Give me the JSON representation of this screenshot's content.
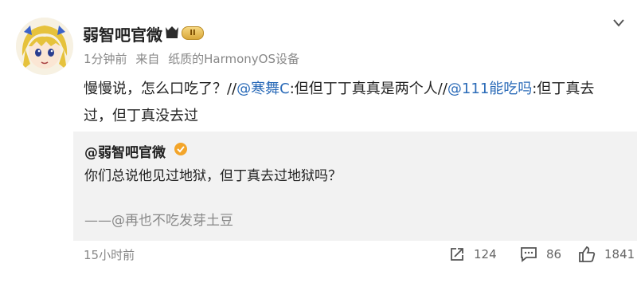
{
  "post": {
    "author": "弱智吧官微",
    "level": "II",
    "time": "1分钟前",
    "source_prefix": "来自",
    "source": "纸质的HarmonyOS设备",
    "content": [
      {
        "text": "慢慢说，怎么口吃了？//",
        "mention": false
      },
      {
        "text": "@寒舞C",
        "mention": true
      },
      {
        "text": ":但但丁丁真真是两个人//",
        "mention": false
      },
      {
        "text": "@111能吃吗",
        "mention": true
      },
      {
        "text": ":但丁真去过，但丁真没去过",
        "mention": false
      }
    ],
    "quote": {
      "author": "@弱智吧官微",
      "text": "你们总说他见过地狱，但丁真去过地狱吗？",
      "signature": "——@再也不吃发芽土豆"
    },
    "footer": {
      "time": "15小时前",
      "shares": "124",
      "comments": "86",
      "likes": "1841"
    }
  },
  "colors": {
    "mention": "#2b6bb8",
    "badge_gold": "#d9a83a",
    "quote_bg": "#f2f2f2",
    "muted": "#888888"
  },
  "icons": {
    "share": "share-icon",
    "comment": "comment-icon",
    "like": "thumbs-up-icon",
    "more": "chevron-down-icon",
    "verified": "verified-icon"
  }
}
